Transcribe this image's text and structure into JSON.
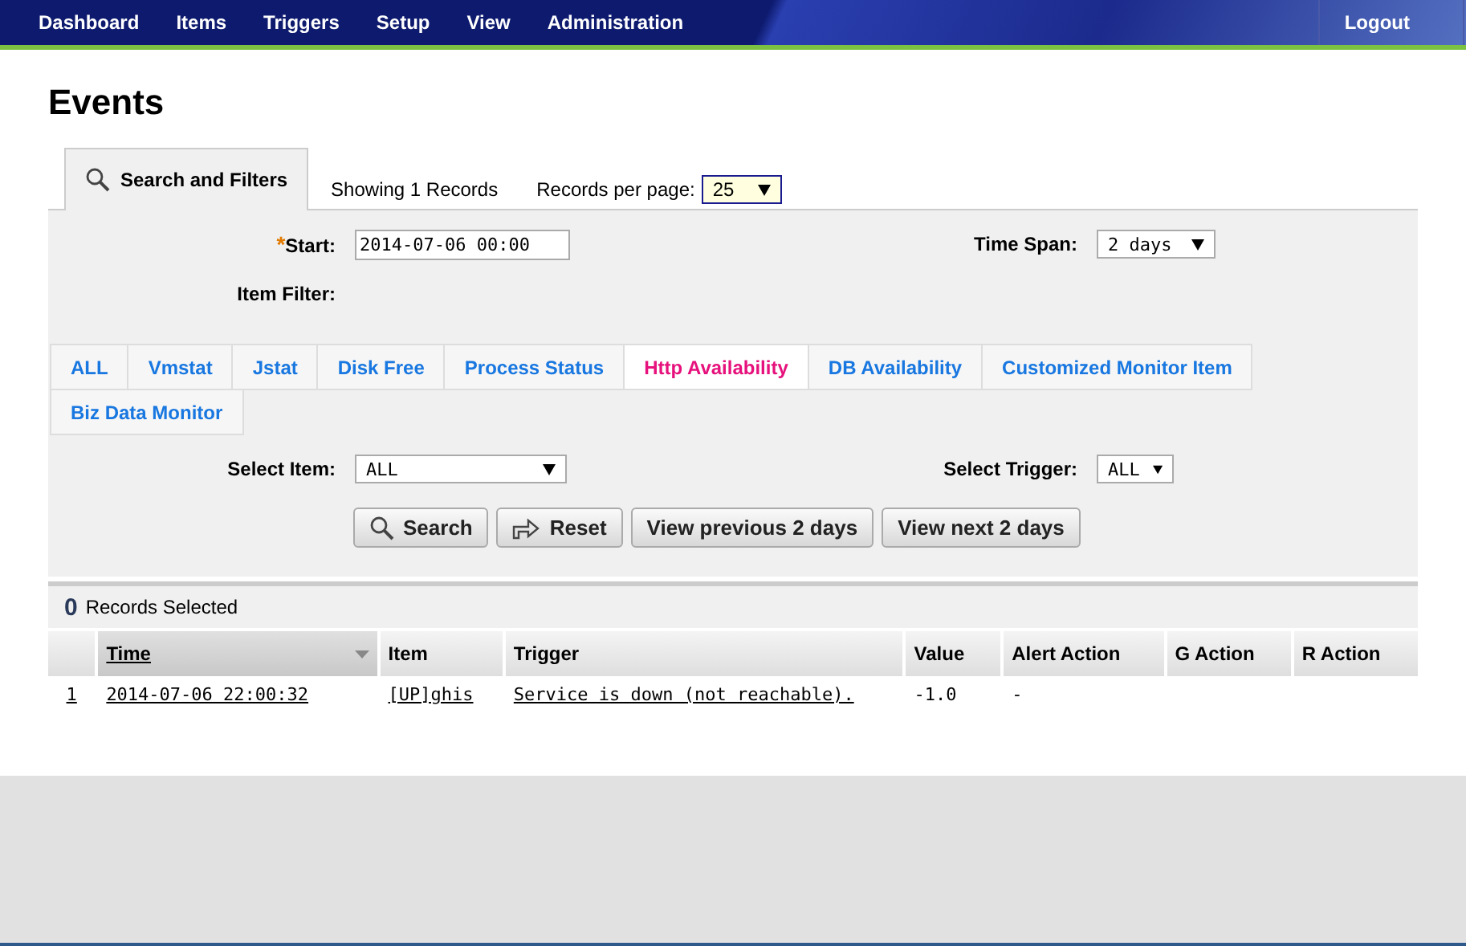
{
  "nav": {
    "items": [
      {
        "label": "Dashboard"
      },
      {
        "label": "Items"
      },
      {
        "label": "Triggers"
      },
      {
        "label": "Setup"
      },
      {
        "label": "View"
      },
      {
        "label": "Administration"
      }
    ],
    "logout": "Logout"
  },
  "page_title": "Events",
  "panel_tab": {
    "label": "Search and Filters",
    "selected": true
  },
  "showing": "Showing 1 Records",
  "per_page": {
    "label": "Records per page:",
    "value": "25"
  },
  "filters": {
    "start": {
      "label": "Start:",
      "required_mark": "*",
      "value": "2014-07-06 00:00"
    },
    "time_span": {
      "label": "Time Span:",
      "value": "2 days"
    },
    "item_filter_label": "Item Filter:",
    "item_tabs": [
      {
        "label": "ALL",
        "selected": false
      },
      {
        "label": "Vmstat",
        "selected": false
      },
      {
        "label": "Jstat",
        "selected": false
      },
      {
        "label": "Disk Free",
        "selected": false
      },
      {
        "label": "Process Status",
        "selected": false
      },
      {
        "label": "Http Availability",
        "selected": true
      },
      {
        "label": "DB Availability",
        "selected": false
      },
      {
        "label": "Customized Monitor Item",
        "selected": false
      },
      {
        "label": "Biz Data Monitor",
        "selected": false
      }
    ],
    "select_item": {
      "label": "Select Item:",
      "value": "ALL"
    },
    "select_trigger": {
      "label": "Select Trigger:",
      "value": "ALL"
    },
    "buttons": [
      {
        "kind": "search",
        "label": "Search"
      },
      {
        "kind": "reset",
        "label": "Reset"
      },
      {
        "kind": "plain",
        "label": "View previous 2 days"
      },
      {
        "kind": "plain",
        "label": "View next 2 days"
      }
    ]
  },
  "selected_count": {
    "count": "0",
    "label": "Records Selected"
  },
  "table": {
    "columns": [
      {
        "label": "Time",
        "sorted": true
      },
      {
        "label": "Item",
        "sorted": false
      },
      {
        "label": "Trigger",
        "sorted": false
      },
      {
        "label": "Value",
        "sorted": false
      },
      {
        "label": "Alert Action",
        "sorted": false
      },
      {
        "label": "G Action",
        "sorted": false
      },
      {
        "label": "R Action",
        "sorted": false
      }
    ],
    "rows": [
      {
        "number": "1",
        "cells": [
          "2014-07-06 22:00:32",
          "[UP]ghis",
          "Service is down (not reachable).",
          "-1.0",
          "-",
          "",
          ""
        ]
      }
    ]
  }
}
